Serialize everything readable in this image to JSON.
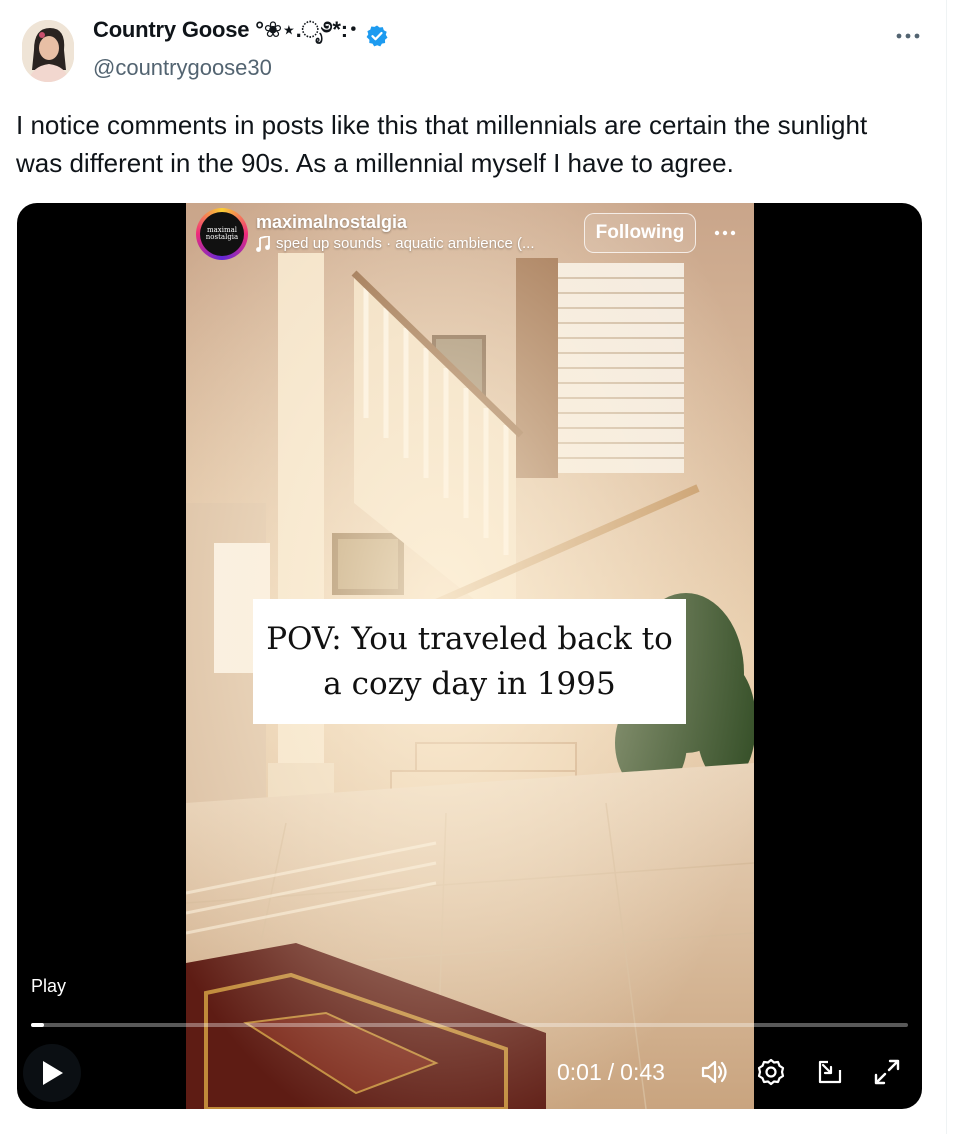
{
  "author": {
    "display_name": "Country Goose °❀⋆.ೃ࿔*:･",
    "handle": "@countrygoose30",
    "verified": true
  },
  "tweet": {
    "text": "I notice comments in posts like this that millennials are certain the sunlight was different in the 90s. As a millennial myself I have to agree."
  },
  "embedded_post": {
    "username": "maximalnostalgia",
    "avatar_text": "maximal nostalgia",
    "audio": "sped up sounds · aquatic ambience (...",
    "follow_label": "Following",
    "caption_line1": "POV: You traveled back to",
    "caption_line2": "a cozy day in 1995"
  },
  "video": {
    "play_label": "Play",
    "elapsed": "0:01",
    "separator": "/",
    "duration": "0:43",
    "progress_fraction": 0.015
  },
  "colors": {
    "verified_blue": "#1d9bf0",
    "secondary_text": "#536471"
  },
  "icons": [
    "more-icon",
    "verified-badge-icon",
    "music-note-icon",
    "play-icon",
    "volume-icon",
    "settings-icon",
    "pip-icon",
    "fullscreen-icon"
  ]
}
